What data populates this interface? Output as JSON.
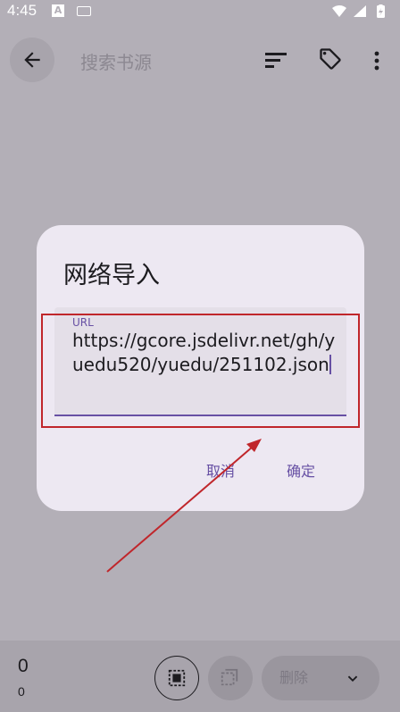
{
  "status_bar": {
    "time": "4:45",
    "app_icon_letter": "A"
  },
  "app_bar": {
    "search_placeholder": "搜索书源"
  },
  "dialog": {
    "title": "网络导入",
    "url_field": {
      "label": "URL",
      "value": "https://gcore.jsdelivr.net/gh/yuedu520/yuedu/251102.json"
    },
    "cancel_label": "取消",
    "confirm_label": "确定"
  },
  "bottom_bar": {
    "selected_count": "0",
    "total_count": "0",
    "delete_label": "删除"
  },
  "colors": {
    "accent": "#6750a4",
    "annotation_red": "#c0262b"
  },
  "icons": [
    "back-arrow-icon",
    "sort-icon",
    "tag-icon",
    "more-vert-icon",
    "select-all-icon",
    "invert-selection-icon",
    "chevron-down-icon"
  ]
}
